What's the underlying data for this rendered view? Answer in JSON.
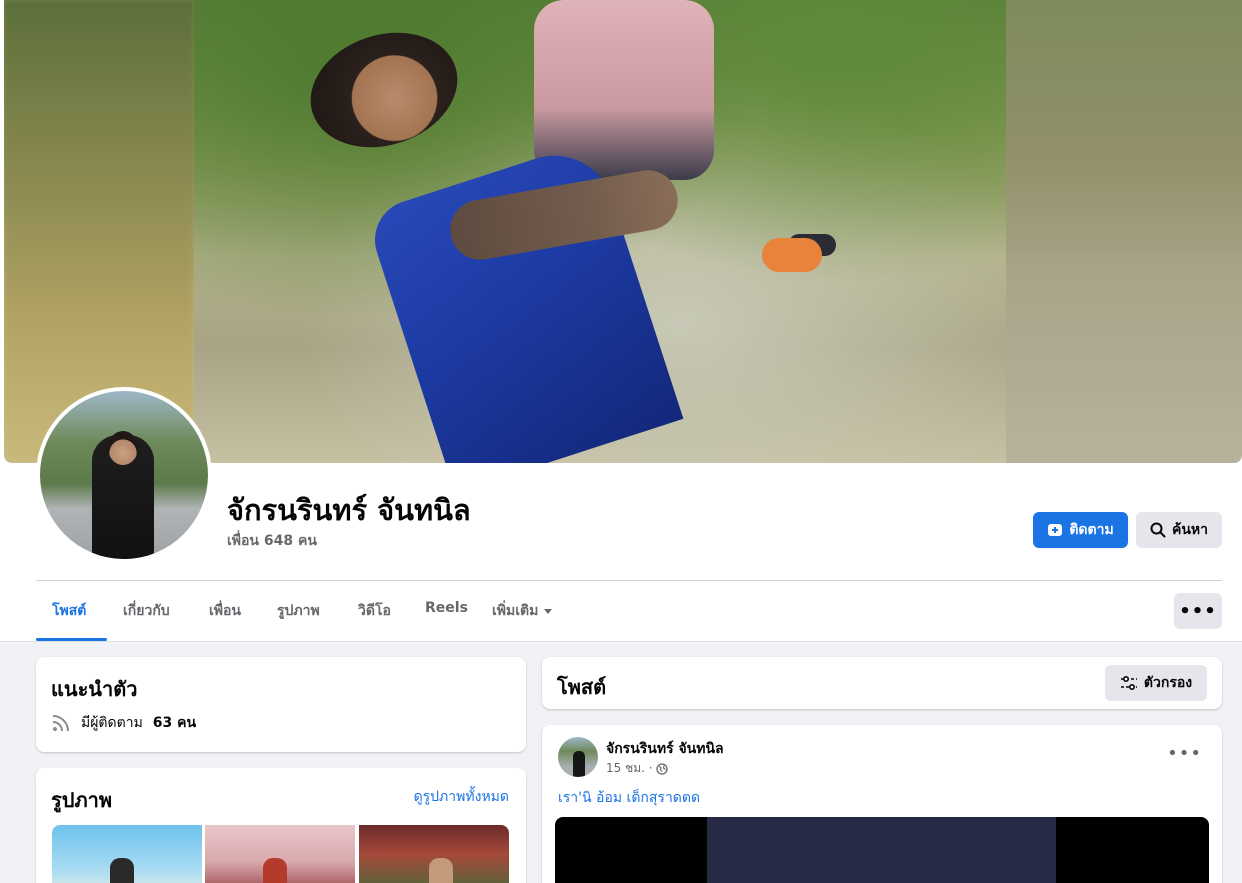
{
  "profile": {
    "name": "จักรนรินทร์ จันทนิล",
    "friends": "เพื่อน 648 คน"
  },
  "actions": {
    "follow": "ติดตาม",
    "search": "ค้นหา",
    "more": "•••"
  },
  "tabs": [
    {
      "label": "โพสต์",
      "active": true
    },
    {
      "label": "เกี่ยวกับ"
    },
    {
      "label": "เพื่อน"
    },
    {
      "label": "รูปภาพ"
    },
    {
      "label": "วิดีโอ"
    },
    {
      "label": "Reels"
    },
    {
      "label": "เพิ่มเติม"
    }
  ],
  "intro": {
    "title": "แนะนำตัว",
    "followers_prefix": "มีผู้ติดตาม",
    "followers_count": "63 คน"
  },
  "photos": {
    "title": "รูปภาพ",
    "see_all": "ดูรูปภาพทั้งหมด"
  },
  "posts": {
    "title": "โพสต์",
    "filter": "ตัวกรอง"
  },
  "post": {
    "author": "จักรนรินทร์ จันทนิล",
    "time": "15 ชม. ·",
    "text": "เรา'นิ อ้อม เด็กสุราดตด",
    "menu": "•••"
  },
  "colors": {
    "accent": "#1b74e4",
    "secondary_text": "#65676b",
    "button_gray": "#e4e6eb",
    "page_bg": "#f0f2f5"
  }
}
